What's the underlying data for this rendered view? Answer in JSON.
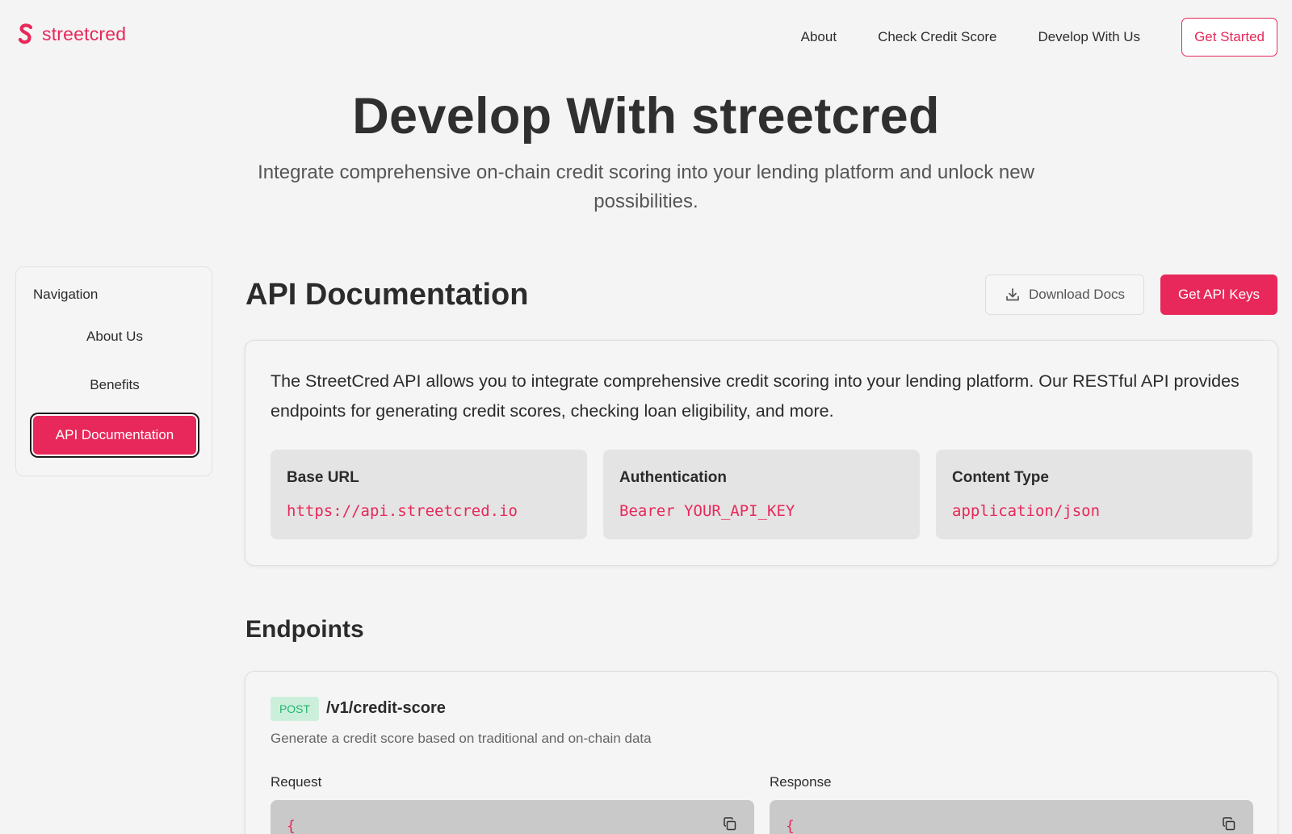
{
  "brand": {
    "name": "streetcred",
    "accent": "#e8285a"
  },
  "header": {
    "nav": [
      "About",
      "Check Credit Score",
      "Develop With Us"
    ],
    "cta": "Get Started"
  },
  "hero": {
    "title": "Develop With streetcred",
    "subtitle": "Integrate comprehensive on-chain credit scoring into your lending platform and unlock new possibilities."
  },
  "sidebar": {
    "heading": "Navigation",
    "items": [
      {
        "label": "About Us",
        "active": false
      },
      {
        "label": "Benefits",
        "active": false
      },
      {
        "label": "API Documentation",
        "active": true
      }
    ]
  },
  "main": {
    "title": "API Documentation",
    "download_label": "Download Docs",
    "keys_label": "Get API Keys",
    "intro": "The StreetCred API allows you to integrate comprehensive credit scoring into your lending platform. Our RESTful API provides endpoints for generating credit scores, checking loan eligibility, and more.",
    "info": [
      {
        "label": "Base URL",
        "value": "https://api.streetcred.io"
      },
      {
        "label": "Authentication",
        "value": "Bearer YOUR_API_KEY"
      },
      {
        "label": "Content Type",
        "value": "application/json"
      }
    ]
  },
  "endpoints": {
    "title": "Endpoints",
    "items": [
      {
        "method": "POST",
        "path": "/v1/credit-score",
        "description": "Generate a credit score based on traditional and on-chain data",
        "request_label": "Request",
        "response_label": "Response",
        "request_code_start": "{",
        "response_code_start": "{"
      }
    ]
  },
  "icons": {
    "logo": "streetcred-s-icon",
    "download": "download-icon",
    "copy": "copy-icon"
  },
  "colors": {
    "accent": "#e8285a",
    "post_badge_bg": "#ccefdc",
    "post_badge_text": "#21b56b",
    "page_bg": "#f4f4f4"
  }
}
